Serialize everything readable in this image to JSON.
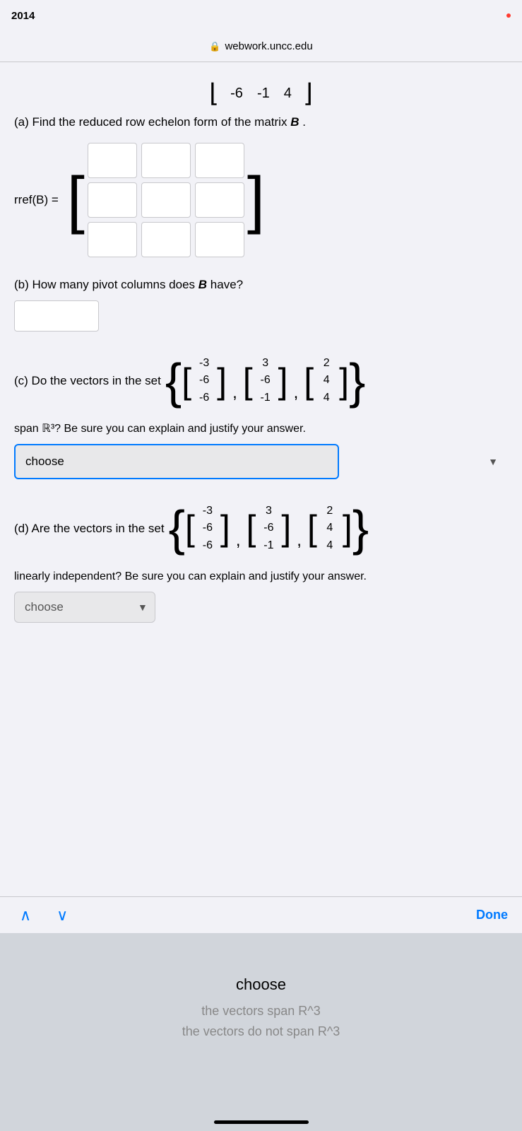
{
  "statusBar": {
    "time": "2014",
    "indicator": "red"
  },
  "addressBar": {
    "url": "webwork.uncc.edu",
    "lock": "🔒"
  },
  "topMatrix": {
    "values": [
      "-6",
      "-1",
      "4"
    ]
  },
  "partA": {
    "label": "(a) Find the reduced row echelon form of the matrix",
    "bold": "B",
    "rrefLabel": "rref(B) ="
  },
  "partB": {
    "label": "(b) How many pivot columns does",
    "bold": "B",
    "labelEnd": "have?"
  },
  "partC": {
    "label": "(c) Do the vectors in the set",
    "spanText": "span ℝ³? Be sure you can explain and justify your answer.",
    "dropdownValue": "choose"
  },
  "vectorSet": {
    "vectors": [
      [
        "-3",
        "-6",
        "-6"
      ],
      [
        "3",
        "-6",
        "-1"
      ],
      [
        "2",
        "4",
        "4"
      ]
    ]
  },
  "partD": {
    "label": "(d) Are the vectors in the set",
    "linearText": "linearly independent? Be sure you can explain and justify your answer.",
    "dropdownValue": "choose"
  },
  "toolbar": {
    "upArrow": "∧",
    "downArrow": "∨",
    "doneLabel": "Done"
  },
  "picker": {
    "selectedLabel": "choose",
    "option1": "the vectors span R^3",
    "option2": "the vectors do not span R^3"
  }
}
